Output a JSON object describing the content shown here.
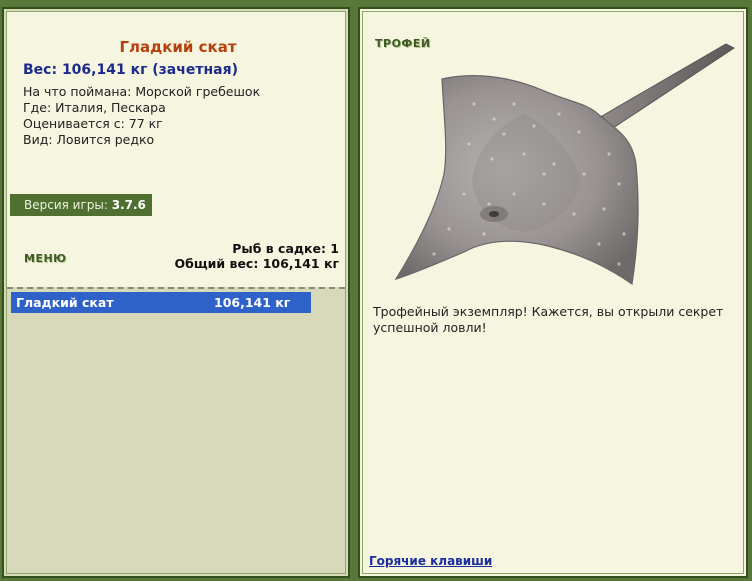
{
  "fish": {
    "name": "Гладкий скат",
    "weight_line": "Вес: 106,141 кг (зачетная)",
    "bait": "На что поймана: Морской гребешок",
    "location": "Где: Италия, Пескара",
    "valued": "Оценивается с: 77 кг",
    "kind": "Вид: Ловится редко"
  },
  "version": {
    "label": "Версия игры:",
    "value": "3.7.6"
  },
  "menu": {
    "label": "МЕНЮ"
  },
  "stats": {
    "count": "Рыб в садке: 1",
    "total": "Общий вес: 106,141 кг"
  },
  "catch_list": [
    {
      "name": "Гладкий скат",
      "weight": "106,141 кг"
    }
  ],
  "trophy": {
    "label": "ТРОФЕЙ",
    "text": "Трофейный экземпляр! Кажется, вы открыли секрет успешной ловли!"
  },
  "hotkeys": {
    "label": "Горячие клавиши"
  }
}
